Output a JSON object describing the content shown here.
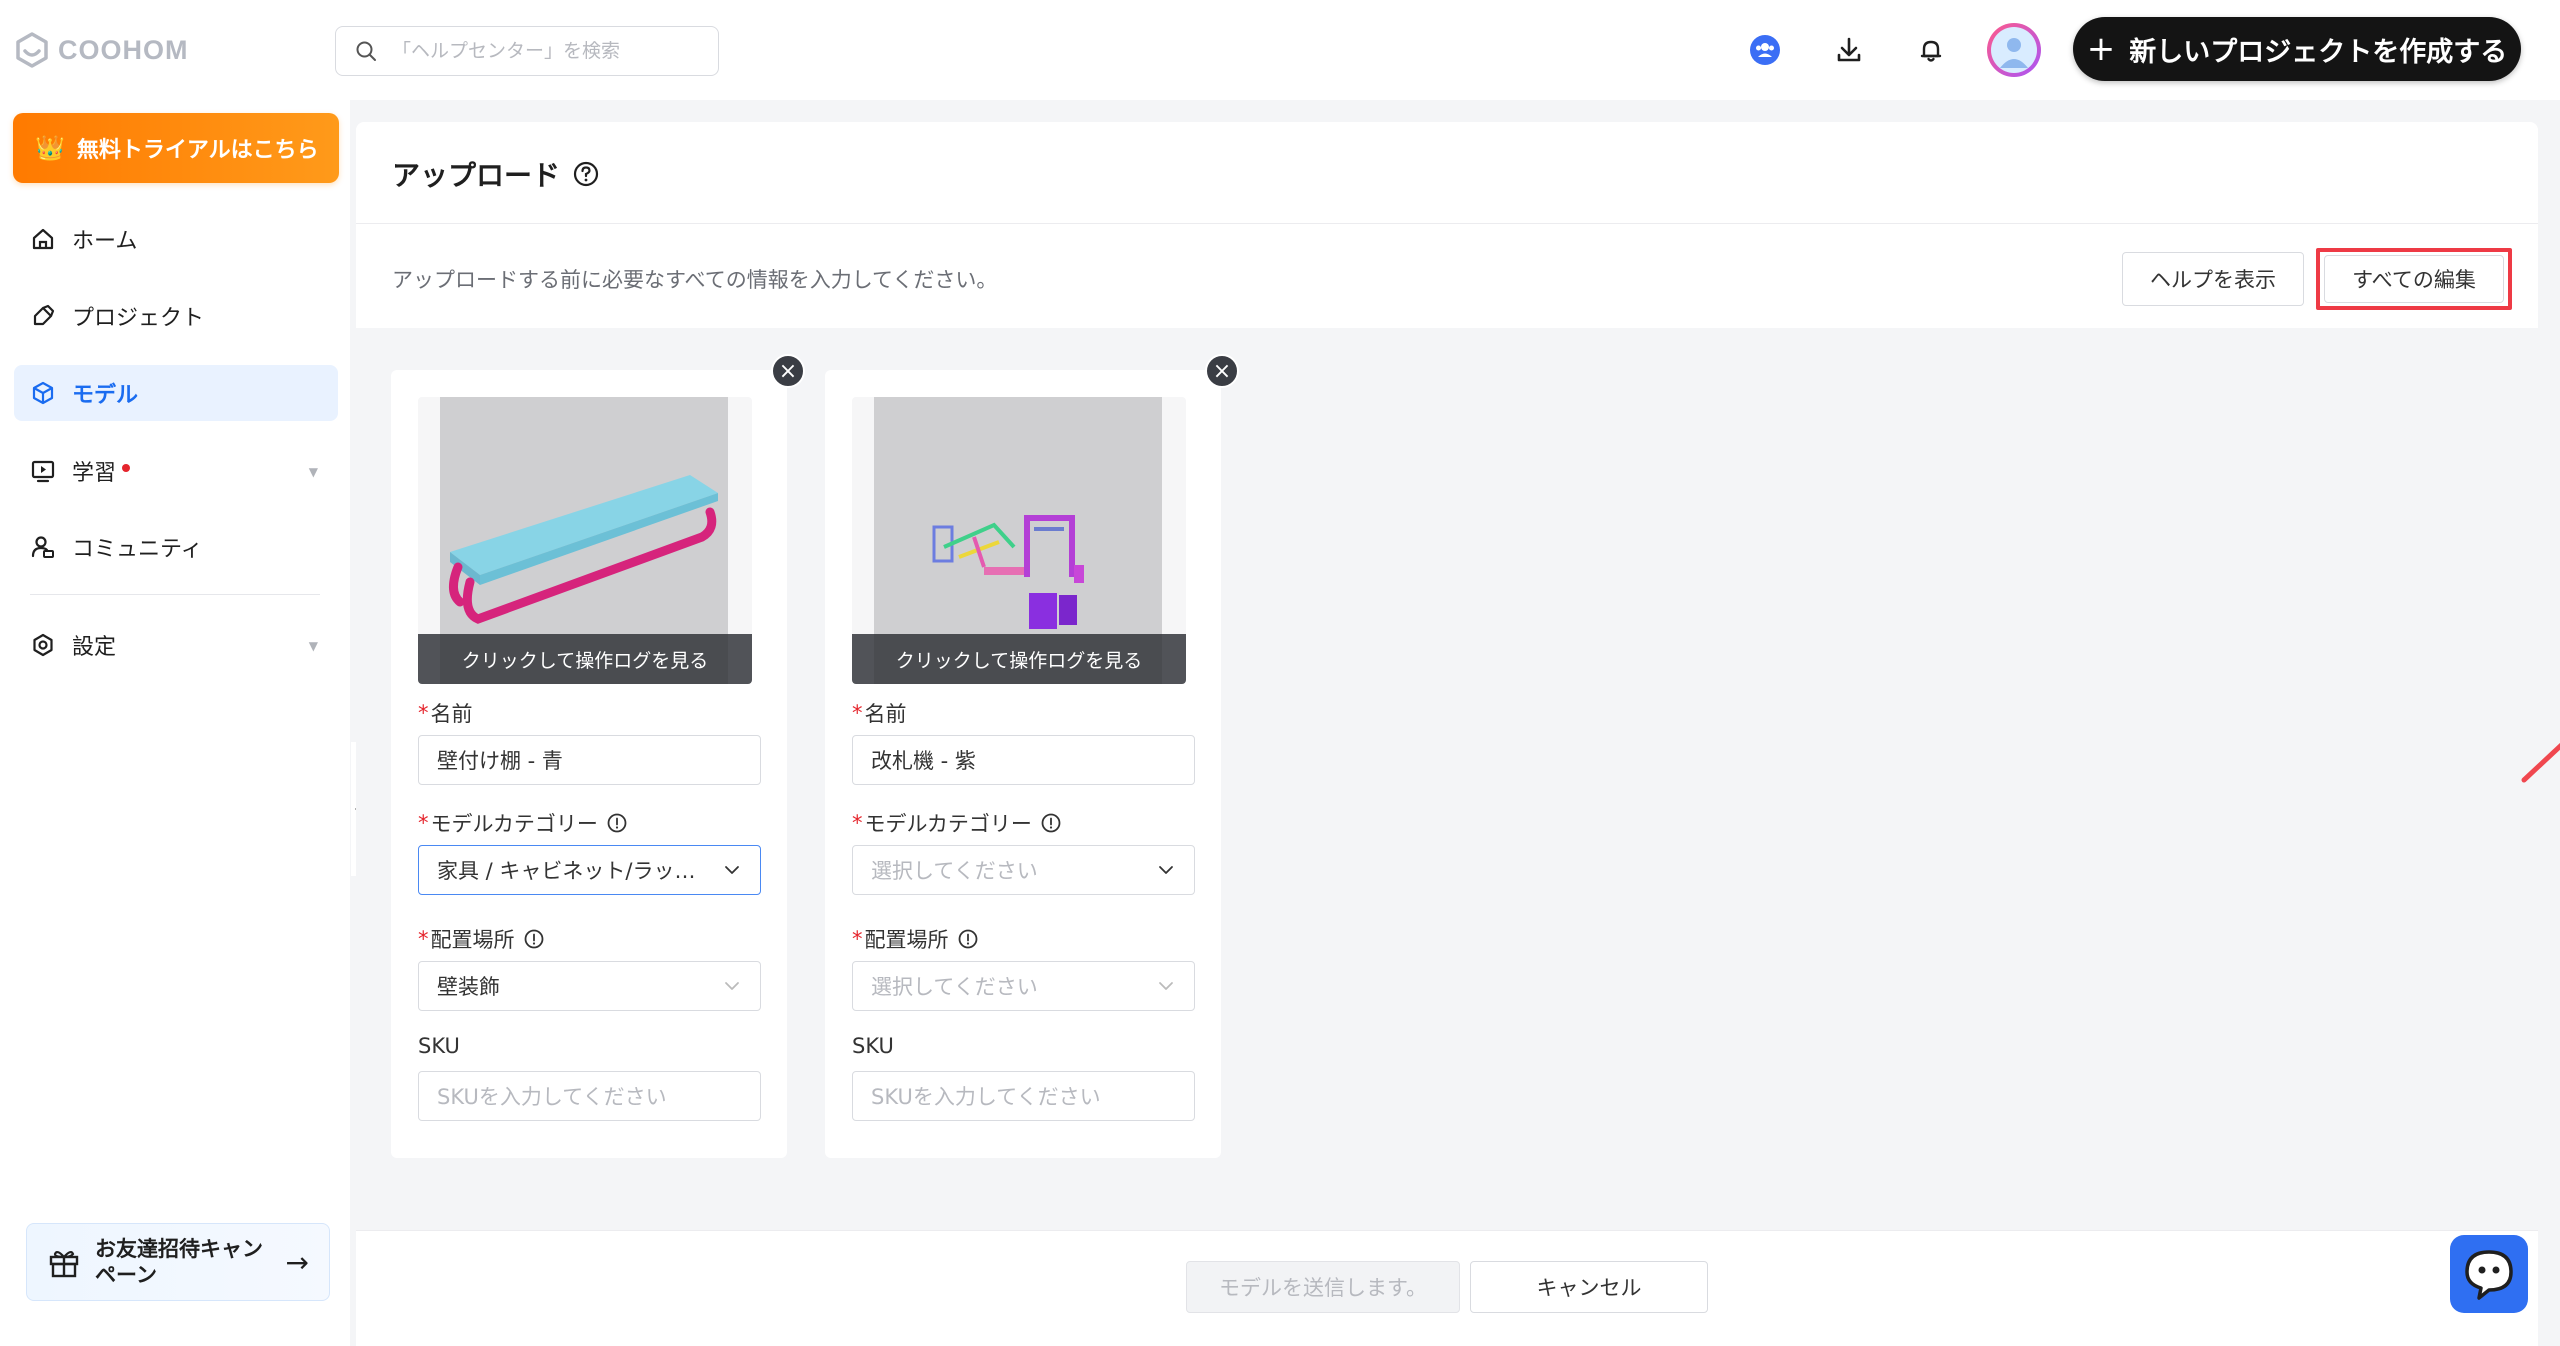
{
  "app": {
    "logo_text": "COOHOM"
  },
  "search": {
    "placeholder": "「ヘルプセンター」を検索"
  },
  "header": {
    "create_label": "新しいプロジェクトを作成する"
  },
  "sidebar": {
    "trial_label": "無料トライアルはこちら",
    "items": [
      {
        "label": "ホーム"
      },
      {
        "label": "プロジェクト"
      },
      {
        "label": "モデル"
      },
      {
        "label": "学習"
      },
      {
        "label": "コミュニティ"
      },
      {
        "label": "設定"
      }
    ],
    "invite_label": "お友達招待キャンペーン"
  },
  "page": {
    "title": "アップロード",
    "subtitle": "アップロードする前に必要なすべての情報を入力してください。",
    "help_button": "ヘルプを表示",
    "edit_all_button": "すべての編集"
  },
  "labels": {
    "name": "名前",
    "category": "モデルカテゴリー",
    "placement": "配置場所",
    "sku": "SKU",
    "thumb_caption": "クリックして操作ログを見る",
    "select_placeholder": "選択してください",
    "sku_placeholder": "SKUを入力してください"
  },
  "cards": [
    {
      "name_value": "壁付け棚 - 青",
      "category_value": "家具 / キャビネット/ラック/棚",
      "placement_value": "壁装飾"
    },
    {
      "name_value": "改札機 - 紫",
      "category_value": "",
      "placement_value": ""
    }
  ],
  "footer": {
    "submit_label": "モデルを送信します。",
    "cancel_label": "キャンセル"
  },
  "colors": {
    "accent": "#1a6cf0",
    "trial": "#ff8a00",
    "highlight": "#ee3a45"
  }
}
